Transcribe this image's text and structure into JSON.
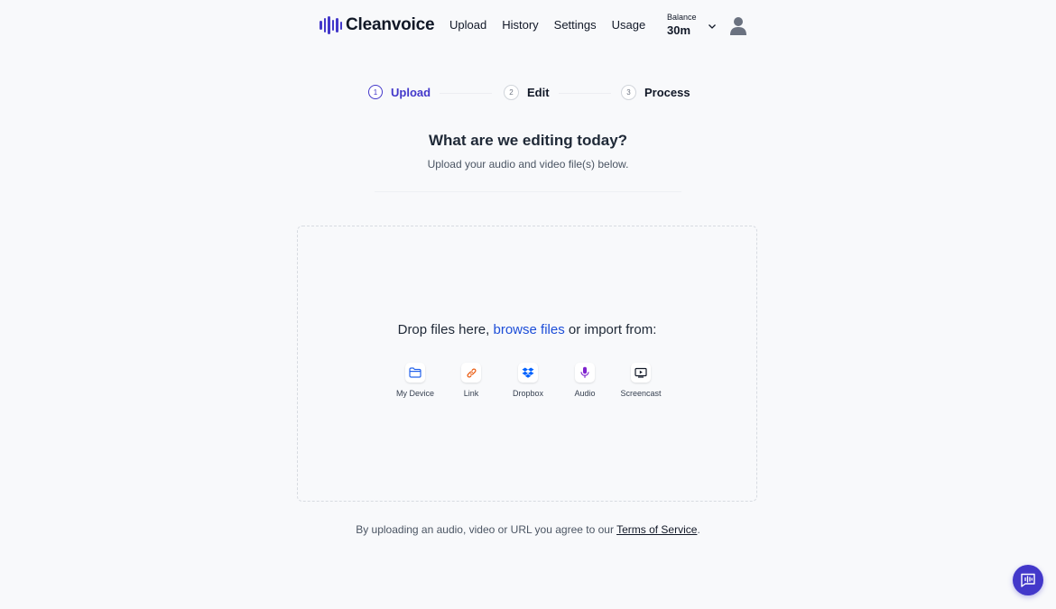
{
  "brand": {
    "name": "Cleanvoice",
    "accent": "#4338ca"
  },
  "nav": {
    "items": [
      {
        "label": "Upload"
      },
      {
        "label": "History"
      },
      {
        "label": "Settings"
      },
      {
        "label": "Usage"
      }
    ]
  },
  "balance": {
    "label": "Balance",
    "value": "30m"
  },
  "stepper": {
    "steps": [
      {
        "number": "1",
        "label": "Upload",
        "state": "active"
      },
      {
        "number": "2",
        "label": "Edit",
        "state": "inactive"
      },
      {
        "number": "3",
        "label": "Process",
        "state": "inactive"
      }
    ]
  },
  "main": {
    "title": "What are we editing today?",
    "subtitle": "Upload your audio and video file(s) below."
  },
  "dropzone": {
    "text_before": "Drop files here, ",
    "browse_link": "browse files",
    "text_after": " or import from:",
    "sources": [
      {
        "label": "My Device",
        "icon": "folder-icon"
      },
      {
        "label": "Link",
        "icon": "link-icon"
      },
      {
        "label": "Dropbox",
        "icon": "dropbox-icon"
      },
      {
        "label": "Audio",
        "icon": "microphone-icon"
      },
      {
        "label": "Screencast",
        "icon": "screencast-icon"
      }
    ]
  },
  "terms": {
    "text_before": "By uploading an audio, video or URL you agree to our ",
    "link": "Terms of Service",
    "text_after": "."
  },
  "chat": {
    "icon": "chat-icon"
  }
}
